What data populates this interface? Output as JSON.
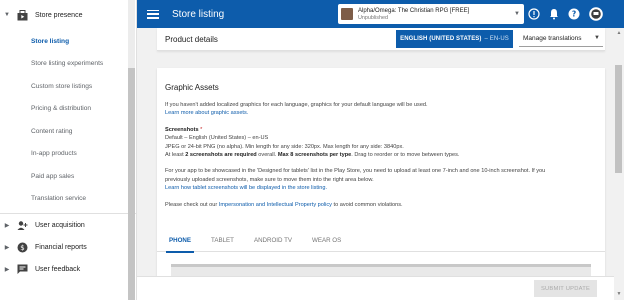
{
  "sidebar": {
    "store_presence": "Store presence",
    "items": [
      {
        "label": "Store listing",
        "active": true
      },
      {
        "label": "Store listing experiments"
      },
      {
        "label": "Custom store listings"
      },
      {
        "label": "Pricing & distribution"
      },
      {
        "label": "Content rating"
      },
      {
        "label": "In-app products"
      },
      {
        "label": "Paid app sales"
      },
      {
        "label": "Translation service"
      }
    ],
    "user_acquisition": "User acquisition",
    "financial_reports": "Financial reports",
    "user_feedback": "User feedback"
  },
  "topbar": {
    "title": "Store listing",
    "app_name": "Alpha/Omega: The Christian RPG [FREE]",
    "app_status": "Unpublished"
  },
  "product_bar": {
    "title": "Product details",
    "language_button": "ENGLISH (UNITED STATES)",
    "language_code": "– EN-US",
    "manage_translations": "Manage translations"
  },
  "graphic_assets": {
    "title": "Graphic Assets",
    "intro": "If you haven't added localized graphics for each language, graphics for your default language will be used.",
    "learn_more": "Learn more about graphic assets.",
    "screenshots_label": "Screenshots",
    "required_mark": "*",
    "default_line": "Default – English (United States) – en-US",
    "format_line": "JPEG or 24-bit PNG (no alpha). Min length for any side: 320px. Max length for any side: 3840px.",
    "at_least_pre": "At least ",
    "at_least_bold": "2 screenshots are required",
    "overall_mid": " overall. ",
    "max_bold": "Max 8 screenshots per type",
    "drag_post": ". Drag to reorder or to move between types.",
    "tablets_line1": "For your app to be showcased in the 'Designed for tablets' list in the Play Store, you need to upload at least one 7-inch and one 10-inch screenshot. If you",
    "tablets_line2": "previously uploaded screenshots, make sure to move them into the right area below.",
    "tablets_link": "Learn how tablet screenshots will be displayed in the store listing.",
    "policy_pre": "Please check out our ",
    "policy_link": "Impersonation and Intellectual Property policy",
    "policy_post": " to avoid common violations."
  },
  "tabs": [
    {
      "label": "PHONE",
      "active": true
    },
    {
      "label": "TABLET"
    },
    {
      "label": "ANDROID TV"
    },
    {
      "label": "WEAR OS"
    }
  ],
  "bottom": {
    "submit": "SUBMIT UPDATE"
  },
  "colors": {
    "primary": "#0d5cab",
    "background": "#f1f1f1"
  },
  "icons": [
    "store-icon",
    "user-acquisition-icon",
    "financial-reports-icon",
    "user-feedback-icon",
    "menu-icon",
    "help-outline-icon",
    "bell-icon",
    "help-icon",
    "account-icon",
    "dropdown-icon"
  ]
}
